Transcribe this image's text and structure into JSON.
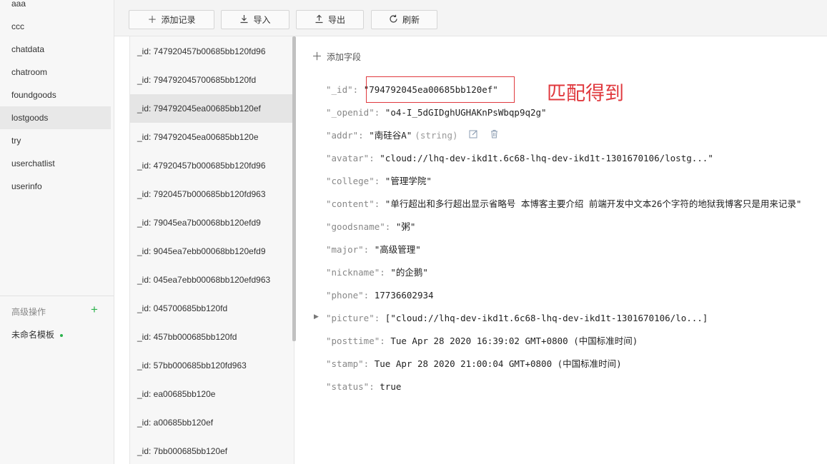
{
  "sidebar": {
    "collections": [
      {
        "label": "aaa"
      },
      {
        "label": "ccc"
      },
      {
        "label": "chatdata"
      },
      {
        "label": "chatroom"
      },
      {
        "label": "foundgoods"
      },
      {
        "label": "lostgoods"
      },
      {
        "label": "try"
      },
      {
        "label": "userchatlist"
      },
      {
        "label": "userinfo"
      }
    ],
    "active_collection": "lostgoods",
    "advanced_title": "高级操作",
    "template_label": "未命名模板"
  },
  "toolbar": {
    "add_record": "添加记录",
    "import": "导入",
    "export": "导出",
    "refresh": "刷新"
  },
  "records": [
    {
      "label": "_id: 747920457b00685bb120fd96"
    },
    {
      "label": "_id: 794792045700685bb120fd"
    },
    {
      "label": "_id: 794792045ea00685bb120ef"
    },
    {
      "label": "_id: 794792045ea00685bb120e"
    },
    {
      "label": "_id: 47920457b000685bb120fd96"
    },
    {
      "label": "_id: 7920457b000685bb120fd963"
    },
    {
      "label": "_id: 79045ea7b00068bb120efd9"
    },
    {
      "label": "_id: 9045ea7ebb00068bb120efd9"
    },
    {
      "label": "_id: 045ea7ebb00068bb120efd963"
    },
    {
      "label": "_id: 045700685bb120fd"
    },
    {
      "label": "_id: 457bb000685bb120fd"
    },
    {
      "label": "_id: 57bb000685bb120fd963"
    },
    {
      "label": "_id: ea00685bb120e"
    },
    {
      "label": "_id: a00685bb120ef"
    },
    {
      "label": "_id: 7bb000685bb120ef"
    }
  ],
  "active_record_index": 2,
  "detail": {
    "add_field": "添加字段",
    "fields": [
      {
        "key": "\"_id\":",
        "value": "\"794792045ea00685bb120ef\""
      },
      {
        "key": "\"_openid\":",
        "value": "\"o4-I_5dGIDghUGHAKnPsWbqp9q2g\""
      },
      {
        "key": "\"addr\":",
        "value": "\"南硅谷A\"",
        "type": "(string)"
      },
      {
        "key": "\"avatar\":",
        "value": "\"cloud://lhq-dev-ikd1t.6c68-lhq-dev-ikd1t-1301670106/lostg...\""
      },
      {
        "key": "\"college\":",
        "value": "\"管理学院\""
      },
      {
        "key": "\"content\":",
        "value": "\"单行超出和多行超出显示省略号 本博客主要介绍 前端开发中文本26个字符的地狱我博客只是用来记录\""
      },
      {
        "key": "\"goodsname\":",
        "value": "\"粥\""
      },
      {
        "key": "\"major\":",
        "value": "\"高级管理\""
      },
      {
        "key": "\"nickname\":",
        "value": "\"的企鹅\""
      },
      {
        "key": "\"phone\":",
        "value": "17736602934"
      },
      {
        "key": "\"picture\":",
        "value": "[\"cloud://lhq-dev-ikd1t.6c68-lhq-dev-ikd1t-1301670106/lo...]"
      },
      {
        "key": "\"posttime\":",
        "value": "Tue Apr 28 2020 16:39:02 GMT+0800 (中国标准时间)"
      },
      {
        "key": "\"stamp\":",
        "value": "Tue Apr 28 2020 21:00:04 GMT+0800 (中国标准时间)"
      },
      {
        "key": "\"status\":",
        "value": "true"
      }
    ]
  },
  "annotation": {
    "text": "匹配得到",
    "color": "#e0393e"
  },
  "icons": {
    "plus": "plus-icon",
    "import": "download-icon",
    "export": "upload-icon",
    "refresh": "refresh-icon",
    "edit": "edit-icon",
    "delete": "trash-icon",
    "expand": "caret-right-icon"
  }
}
